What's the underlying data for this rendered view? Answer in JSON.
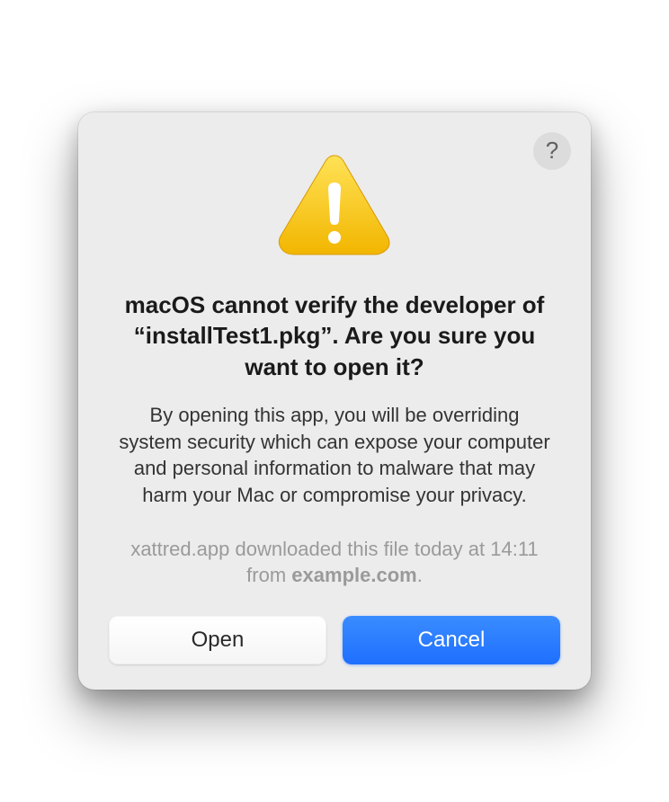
{
  "dialog": {
    "title": "macOS cannot verify the developer of “installTest1.pkg”. Are you sure you want to open it?",
    "body": "By opening this app, you will be overriding system security which can expose your computer and personal information to malware that may harm your Mac or compromise your privacy.",
    "source_prefix": "xattred.app downloaded this file today at 14:11 from ",
    "source_domain": "example.com",
    "source_suffix": ".",
    "help_label": "?",
    "buttons": {
      "open": "Open",
      "cancel": "Cancel"
    }
  }
}
